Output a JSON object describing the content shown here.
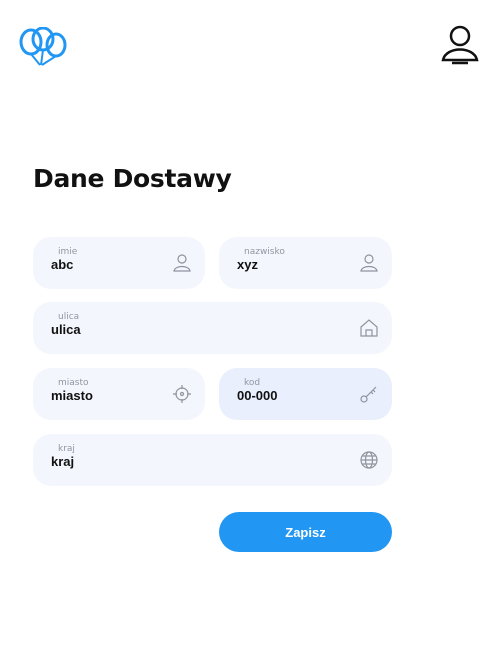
{
  "header": {
    "logo_icon": "balloons-icon",
    "user_icon": "user-icon"
  },
  "page": {
    "title": "Dane Dostawy"
  },
  "form": {
    "imie": {
      "label": "imie",
      "value": "abc",
      "icon": "person-icon"
    },
    "nazwisko": {
      "label": "nazwisko",
      "value": "xyz",
      "icon": "person-icon"
    },
    "ulica": {
      "label": "ulica",
      "value": "ulica",
      "icon": "home-icon"
    },
    "miasto": {
      "label": "miasto",
      "value": "miasto",
      "icon": "crosshair-icon"
    },
    "kod": {
      "label": "kod",
      "value": "00-000",
      "icon": "key-icon"
    },
    "kraj": {
      "label": "kraj",
      "value": "kraj",
      "icon": "globe-icon"
    },
    "save_label": "Zapisz"
  },
  "colors": {
    "accent": "#2196f3",
    "field_bg": "#f3f6fc",
    "icon": "#8e949e"
  }
}
